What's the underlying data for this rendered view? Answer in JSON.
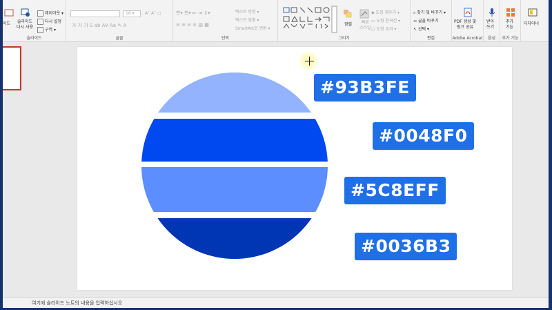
{
  "ribbon": {
    "slides_group": {
      "label": "슬라이드",
      "reuse": "슬라이드\n다시 사용",
      "layout": "레이아웃",
      "reset": "다시 설정",
      "section": "구역",
      "new_slide_partial": "이드"
    },
    "font_group": {
      "label": "글꼴",
      "font_name": "",
      "font_size": "18"
    },
    "paragraph_group": {
      "label": "단락",
      "text_direction": "텍스트 방향",
      "align_text": "텍스트 맞춤",
      "smartart": "SmartArt로 변환"
    },
    "drawing_group": {
      "label": "그리기",
      "arrange": "정렬",
      "quick_styles": "빠른\n스타일",
      "shape_fill": "도형 채우기",
      "shape_outline": "도형 윤곽선",
      "shape_effects": "도형 효과"
    },
    "editing_group": {
      "label": "편집",
      "find": "찾기 및 바꾸기",
      "replace": "글꼴 바꾸기",
      "select": "선택"
    },
    "acrobat_group": {
      "label": "Adobe Acrobat",
      "create_pdf": "PDF 생성 및\n링크 공유"
    },
    "voice_group": {
      "label": "음성",
      "dictate": "받아\n쓰기"
    },
    "addins_group": {
      "label": "추가 기능",
      "addins": "추가\n기능"
    },
    "designer_group": {
      "designer": "디자이너"
    }
  },
  "notes_placeholder": "여기에 슬라이드 노트의 내용을 입력하십시오",
  "swatches": [
    {
      "label": "#93B3FE",
      "color": "#93B3FE"
    },
    {
      "label": "#0048F0",
      "color": "#0048F0"
    },
    {
      "label": "#5C8EFF",
      "color": "#5C8EFF"
    },
    {
      "label": "#0036B3",
      "color": "#0036B3"
    }
  ],
  "colors": {
    "label_bg": "#1F6FE6",
    "frame": "#14326E",
    "thumb_border": "#C0392B"
  }
}
